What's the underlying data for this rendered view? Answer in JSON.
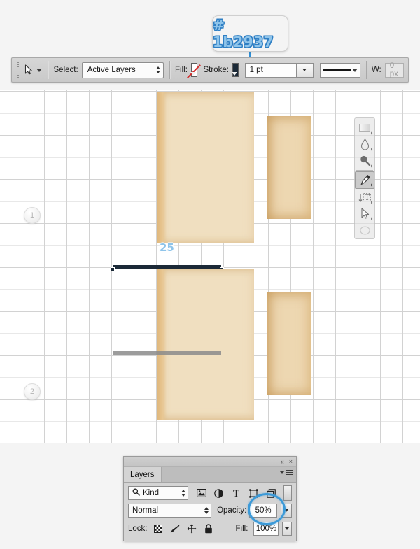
{
  "callout": {
    "value": "# 1b2937",
    "accent_color": "#2f8fd6",
    "text_color": "#8ec4ea"
  },
  "options_bar": {
    "tool_icon": "path-selection-arrow-icon",
    "select_label": "Select:",
    "select_value": "Active Layers",
    "fill_label": "Fill:",
    "fill_value": "none",
    "stroke_label": "Stroke:",
    "stroke_color": "#1b2937",
    "stroke_weight": "1 pt",
    "stroke_style": "solid",
    "width_label": "W:",
    "width_value": "0 px"
  },
  "canvas": {
    "grid_color": "#d2d2d2",
    "background": "#ffffff",
    "shape_color": "#f0dfc0",
    "steps": [
      {
        "number": "1",
        "measure": "25",
        "line_color": "#1b2937"
      },
      {
        "number": "2",
        "measure": "",
        "line_color": "#8b8b8b"
      }
    ]
  },
  "tools_palette": {
    "items": [
      {
        "name": "gradient-tool",
        "active": false
      },
      {
        "name": "blur-droplet-tool",
        "active": false
      },
      {
        "name": "zoom-tool",
        "active": false
      },
      {
        "name": "pen-tool",
        "active": true
      },
      {
        "name": "type-tool",
        "active": false
      },
      {
        "name": "path-selection-tool",
        "active": false
      },
      {
        "name": "ellipse-tool",
        "active": false
      }
    ]
  },
  "layers_panel": {
    "collapse_icon": "«",
    "close_icon": "×",
    "tab_label": "Layers",
    "filter_kind_label": "Kind",
    "filter_icons": [
      "pixel-layer-filter-icon",
      "adjustment-layer-filter-icon",
      "type-layer-filter-icon",
      "shape-layer-filter-icon",
      "smart-object-filter-icon"
    ],
    "blend_mode": "Normal",
    "opacity_label": "Opacity:",
    "opacity_value": "50%",
    "lock_label": "Lock:",
    "lock_icons": [
      "lock-transparency-icon",
      "lock-pixels-icon",
      "lock-position-icon",
      "lock-all-icon"
    ],
    "fill_label": "Fill:",
    "fill_value": "100%",
    "highlight_color": "#3c9ad8"
  }
}
